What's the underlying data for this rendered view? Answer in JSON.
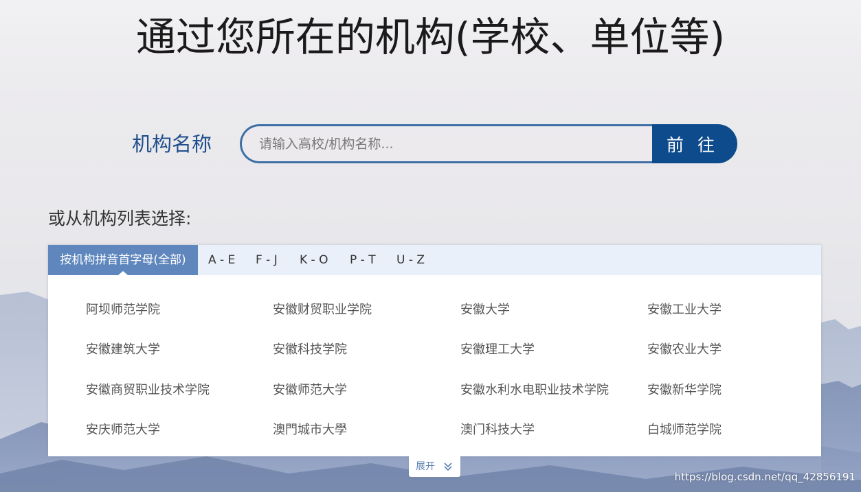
{
  "page": {
    "title": "通过您所在的机构(学校、单位等)"
  },
  "search": {
    "label": "机构名称",
    "placeholder": "请输入高校/机构名称...",
    "button_label": "前 往"
  },
  "list": {
    "hint": "或从机构列表选择:",
    "tabs": [
      {
        "label": "按机构拼音首字母(全部)",
        "active": true
      },
      {
        "label": "A - E",
        "active": false
      },
      {
        "label": "F - J",
        "active": false
      },
      {
        "label": "K - O",
        "active": false
      },
      {
        "label": "P - T",
        "active": false
      },
      {
        "label": "U - Z",
        "active": false
      }
    ],
    "institutions": [
      "阿坝师范学院",
      "安徽财贸职业学院",
      "安徽大学",
      "安徽工业大学",
      "安徽建筑大学",
      "安徽科技学院",
      "安徽理工大学",
      "安徽农业大学",
      "安徽商贸职业技术学院",
      "安徽师范大学",
      "安徽水利水电职业技术学院",
      "安徽新华学院",
      "安庆师范大学",
      "澳門城市大學",
      "澳门科技大学",
      "白城师范学院"
    ],
    "expand_label": "展开"
  },
  "watermark": "https://blog.csdn.net/qq_42856191",
  "colors": {
    "accent": "#0e4b8c",
    "tab_active": "#5f87bd",
    "tab_bar": "#e9f0f9",
    "label_blue": "#1f4e8c"
  },
  "icons": {
    "expand": "double-chevron-down-icon"
  }
}
